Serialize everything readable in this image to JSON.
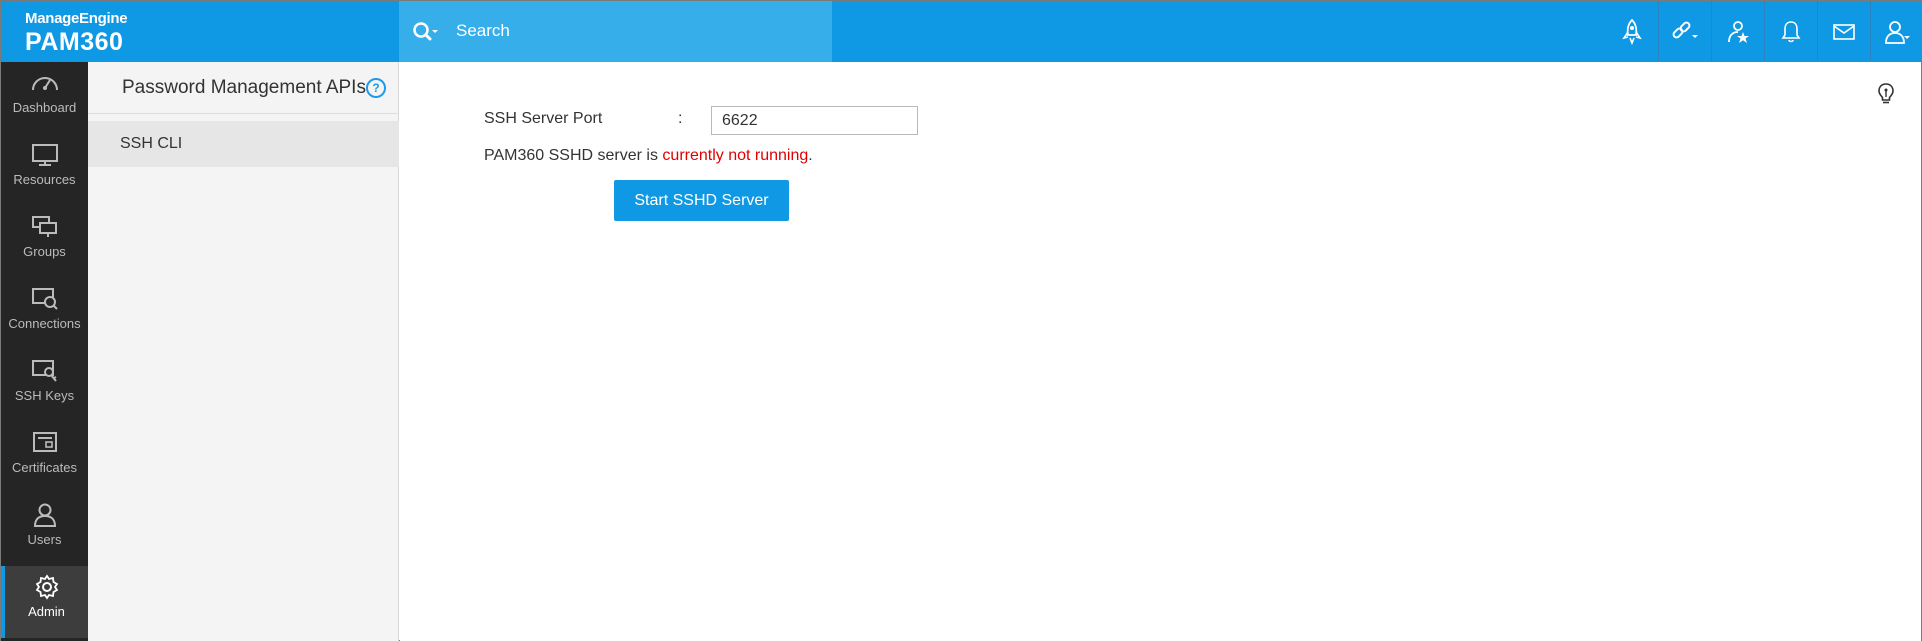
{
  "brand": {
    "company": "ManageEngine",
    "product": "PAM360"
  },
  "search": {
    "placeholder": "Search",
    "icon": "search-icon"
  },
  "header_icons": [
    {
      "name": "launch-icon"
    },
    {
      "name": "link-icon"
    },
    {
      "name": "favorite-icon"
    },
    {
      "name": "bell-icon"
    },
    {
      "name": "mail-icon"
    },
    {
      "name": "user-account-icon"
    }
  ],
  "nav": {
    "items": [
      {
        "label": "Dashboard",
        "icon": "gauge-icon"
      },
      {
        "label": "Resources",
        "icon": "monitor-icon"
      },
      {
        "label": "Groups",
        "icon": "groups-icon"
      },
      {
        "label": "Connections",
        "icon": "connections-icon"
      },
      {
        "label": "SSH Keys",
        "icon": "key-icon"
      },
      {
        "label": "Certificates",
        "icon": "certificate-icon"
      },
      {
        "label": "Users",
        "icon": "user-icon"
      },
      {
        "label": "Admin",
        "icon": "gear-icon",
        "active": true
      }
    ]
  },
  "subpanel": {
    "title": "Password Management APIs",
    "help": "?",
    "items": [
      {
        "label": "SSH CLI",
        "selected": true
      }
    ]
  },
  "main": {
    "port_label": "SSH Server Port",
    "colon": ":",
    "port_value": "6622",
    "status_prefix": "PAM360 SSHD server is ",
    "status_value": "currently not running",
    "status_suffix": ".",
    "start_button": "Start SSHD Server"
  },
  "colors": {
    "topbar": "#0f98e4",
    "search_bg": "#35aeea",
    "nav_bg": "#252525",
    "status_error": "#e00000"
  }
}
